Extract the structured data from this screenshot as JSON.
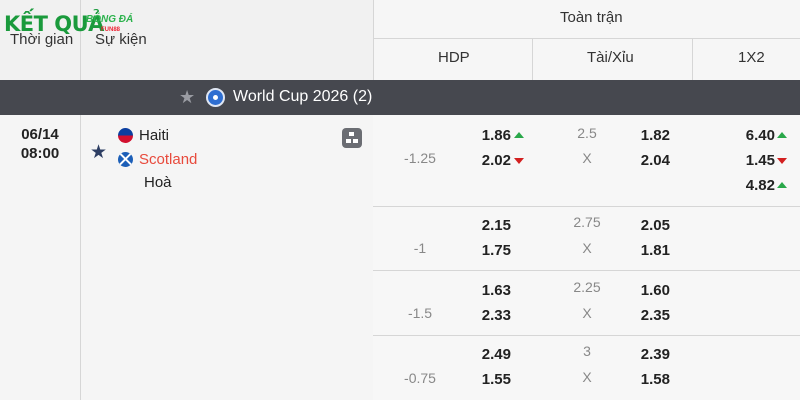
{
  "logo": {
    "text": "KẾT QUẢ",
    "sub": "BÓNG ĐÁ",
    "tag": "FUN88"
  },
  "header": {
    "time_label": "Thời gian",
    "event_label": "Sự kiện",
    "full_match": "Toàn trận",
    "hdp": "HDP",
    "ou": "Tài/Xỉu",
    "x12": "1X2"
  },
  "league": {
    "name": "World Cup 2026 (2)"
  },
  "match": {
    "date": "06/14",
    "time": "08:00",
    "home": "Haiti",
    "away": "Scotland",
    "draw": "Hoà",
    "colors": {
      "away": "#e84a3c",
      "arrow_up": "#2aa84a",
      "arrow_down": "#d32020"
    }
  },
  "odds": [
    {
      "hdp_line": "-1.25",
      "hdp_home": "1.86",
      "hdp_away": "2.02",
      "ou_line": "2.5",
      "ou_x": "X",
      "ou_over": "1.82",
      "ou_under": "2.04",
      "x_home": "6.40",
      "x_away": "1.45",
      "x_draw": "4.82"
    },
    {
      "hdp_line": "-1",
      "hdp_home": "2.15",
      "hdp_away": "1.75",
      "ou_line": "2.75",
      "ou_x": "X",
      "ou_over": "2.05",
      "ou_under": "1.81"
    },
    {
      "hdp_line": "-1.5",
      "hdp_home": "1.63",
      "hdp_away": "2.33",
      "ou_line": "2.25",
      "ou_x": "X",
      "ou_over": "1.60",
      "ou_under": "2.35"
    },
    {
      "hdp_line": "-0.75",
      "hdp_home": "2.49",
      "hdp_away": "1.55",
      "ou_line": "3",
      "ou_x": "X",
      "ou_over": "2.39",
      "ou_under": "1.58"
    }
  ]
}
